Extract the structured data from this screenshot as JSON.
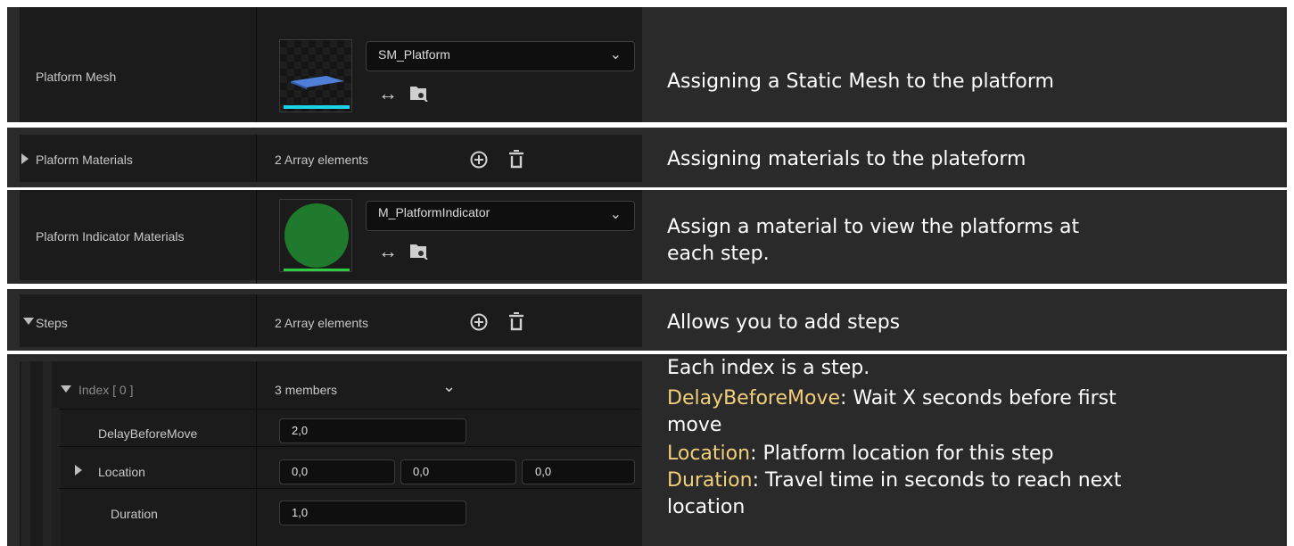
{
  "platform_mesh": {
    "label": "Platform Mesh",
    "asset": "SM_Platform",
    "description": "Assigning a Static Mesh to the platform"
  },
  "platform_materials": {
    "label": "Plaform Materials",
    "value": "2 Array elements",
    "description": "Assigning materials to the plateform"
  },
  "indicator_materials": {
    "label": "Plaform Indicator Materials",
    "asset": "M_PlatformIndicator",
    "description_line1": "Assign a material to view the platforms at",
    "description_line2": "each step."
  },
  "steps": {
    "label": "Steps",
    "value": "2 Array elements",
    "description": "Allows you to add steps"
  },
  "index0": {
    "label": "Index [ 0 ]",
    "value": "3 members",
    "delay_label": "DelayBeforeMove",
    "delay_value": "2,0",
    "location_label": "Location",
    "location_x": "0,0",
    "location_y": "0,0",
    "location_z": "0,0",
    "duration_label": "Duration",
    "duration_value": "1,0"
  },
  "explanation": {
    "line1": "Each index is a step.",
    "delay_key": "DelayBeforeMove",
    "delay_text": ": Wait X seconds before first",
    "delay_text2": "move",
    "location_key": "Location",
    "location_text": ": Platform location for this step",
    "duration_key": "Duration",
    "duration_text": ": Travel time in seconds to reach next",
    "duration_text2": "location"
  },
  "colors": {
    "highlight": "#f2cf7a",
    "mesh_underline": "#19d4e8",
    "indicator_underline": "#2ecc40",
    "indicator_sphere": "#1f7a2e"
  }
}
